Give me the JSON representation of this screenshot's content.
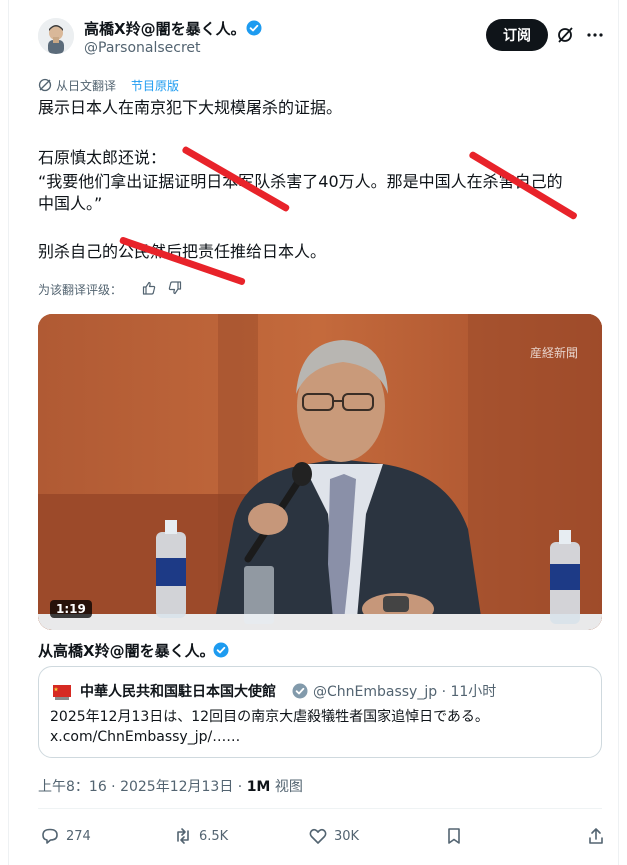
{
  "author": {
    "display_name": "高橋X羚@闇を暴く人。",
    "handle": "@Parsonalsecret"
  },
  "header": {
    "subscribe_label": "订阅"
  },
  "translation": {
    "translated_from": "从日文翻译",
    "show_original": "节目原版",
    "rate_prompt": "为该翻译评级："
  },
  "post": {
    "lines": [
      "展示日本人在南京犯下大规模屠杀的证据。",
      "石原慎太郎还说：",
      "“我要他们拿出证据证明日本军队杀害了40万人。那是中国人在杀害自己的",
      "中国人。”",
      "别杀自己的公民然后把责任推给日本人。"
    ]
  },
  "video": {
    "watermark": "産経新聞",
    "duration": "1:19"
  },
  "repost_from": {
    "prefix": "从",
    "name": "高橋X羚@闇を暴く人。"
  },
  "quote": {
    "name": "中華人民共和国駐日本国大使館",
    "handle": "@ChnEmbassy_jp · 11小时",
    "text_line1": "2025年12月13日は、12回目の南京大虐殺犠牲者国家追悼日である。",
    "text_line2": "x.com/ChnEmbassy_jp/……"
  },
  "meta": {
    "time": "上午8：16 · 2025年12月13日 · ",
    "views": "1M",
    "views_label": " 视图"
  },
  "actions": {
    "replies": "274",
    "reposts": "6.5K",
    "likes": "30K"
  },
  "colors": {
    "accent": "#1d9bf0",
    "strike": "#e8232a",
    "text": "#0f1419",
    "muted": "#536471"
  },
  "icons": [
    "verified-badge-icon",
    "grok-icon",
    "more-icon",
    "translate-icon",
    "thumb-up-icon",
    "thumb-down-icon",
    "china-flag-icon",
    "reply-icon",
    "repost-icon",
    "like-icon",
    "bookmark-icon",
    "share-icon"
  ]
}
